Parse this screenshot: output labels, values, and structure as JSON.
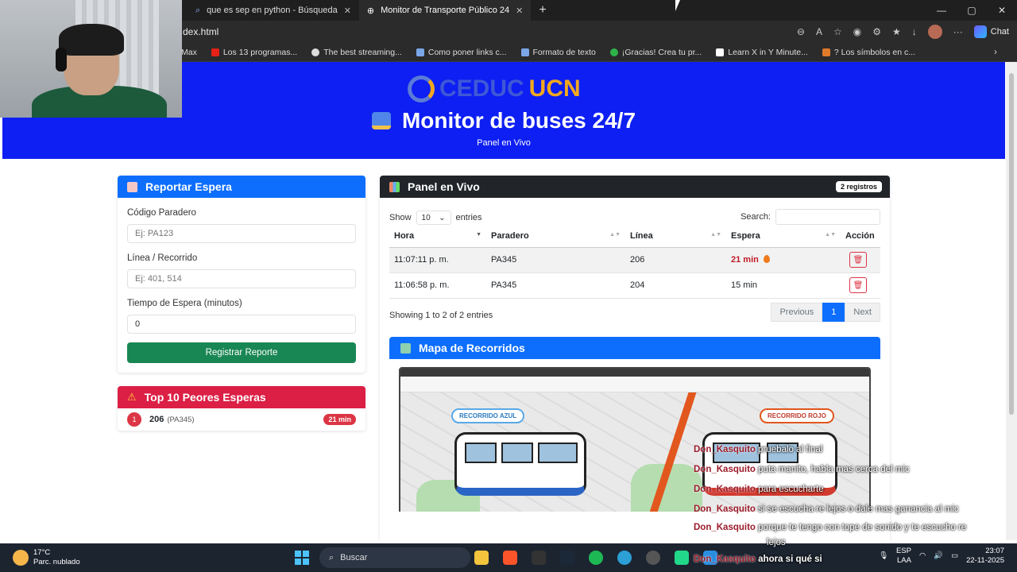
{
  "browser": {
    "tabs": [
      {
        "label": "que es sep en python - Búsqueda",
        "active": false
      },
      {
        "label": "Monitor de Transporte Público 24",
        "active": true
      }
    ],
    "url": "dex.html",
    "chat_label": "Chat",
    "bookmarks": [
      "Max",
      "Los 13 programas...",
      "The best streaming...",
      "Como poner links c...",
      "Formato de texto",
      "¡Gracias! Crea tu pr...",
      "Learn X in Y Minute...",
      "? Los símbolos en c..."
    ]
  },
  "header": {
    "logo_a": "CEDUC",
    "logo_b": "UCN",
    "title": "Monitor de buses 24/7",
    "subtitle": "Panel en Vivo",
    "bg": "#0d1ff2"
  },
  "report": {
    "title": "Reportar Espera",
    "fields": [
      {
        "label": "Código Paradero",
        "placeholder": "Ej: PA123"
      },
      {
        "label": "Línea / Recorrido",
        "placeholder": "Ej: 401, 514"
      },
      {
        "label": "Tiempo de Espera (minutos)",
        "value": "0"
      }
    ],
    "button": "Registrar Reporte"
  },
  "top10": {
    "title": "Top 10 Peores Esperas",
    "items": [
      {
        "rank": "1",
        "line": "206",
        "stop": "(PA345)",
        "wait": "21 min"
      }
    ]
  },
  "panel": {
    "title": "Panel en Vivo",
    "badge": "2 registros",
    "show_label": "Show",
    "show_value": "10",
    "entries_label": "entries",
    "search_label": "Search:",
    "columns": [
      "Hora",
      "Paradero",
      "Línea",
      "Espera",
      "Acción"
    ],
    "rows": [
      {
        "hora": "11:07:11 p. m.",
        "paradero": "PA345",
        "linea": "206",
        "espera": "21 min"
      },
      {
        "hora": "11:06:58 p. m.",
        "paradero": "PA345",
        "linea": "204",
        "espera": "15 min"
      }
    ],
    "info": "Showing 1 to 2 of 2 entries",
    "pager": {
      "prev": "Previous",
      "current": "1",
      "next": "Next"
    }
  },
  "map": {
    "title": "Mapa de Recorridos",
    "tag_blue": "RECORRIDO AZUL",
    "tag_red": "RECORRIDO ROJO"
  },
  "chat": [
    {
      "user": "Don_Kasquito",
      "text": "pruebalo al final"
    },
    {
      "user": "Don_Kasquito",
      "text": "puta manito, habla mas cerca del mic"
    },
    {
      "user": "Don_Kasquito",
      "text": "para escucharte"
    },
    {
      "user": "Don_Kasquito",
      "text": "si se escucha re lejos o dale mas ganancia al mic"
    },
    {
      "user": "Don_Kasquito",
      "text": "porque te tengo con tope de sonido y te escucho re"
    },
    {
      "user": "",
      "text": "lejos"
    },
    {
      "user": "Don_Kasquito",
      "text": "ahora si qué si"
    }
  ],
  "taskbar": {
    "temp": "17°C",
    "weather": "Parc. nublado",
    "search": "Buscar",
    "lang_a": "ESP",
    "lang_b": "LAA",
    "time": "23:07",
    "date": "22-11-2025"
  }
}
